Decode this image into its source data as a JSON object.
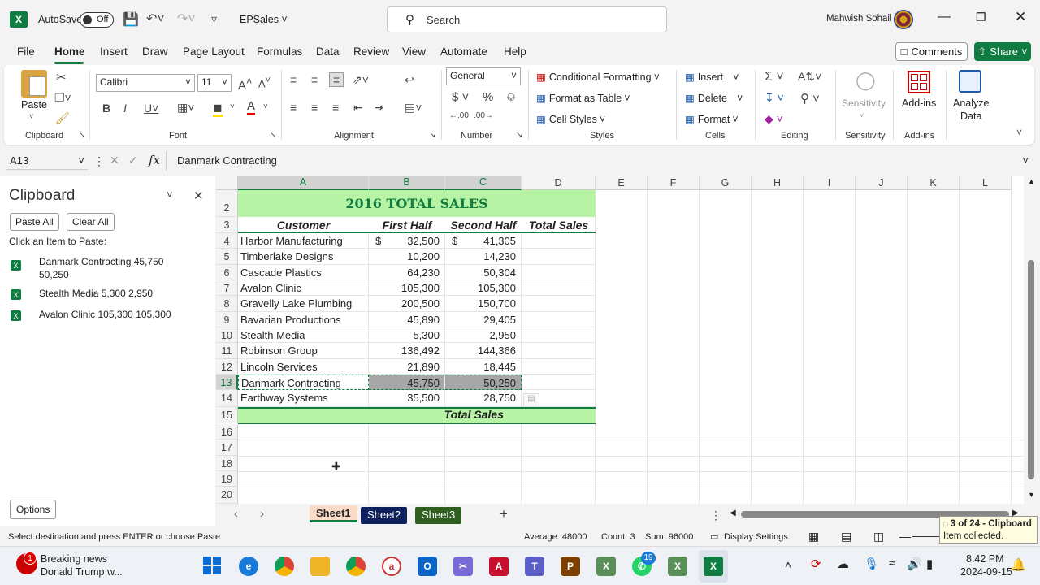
{
  "title_bar": {
    "autosave_label": "AutoSave",
    "autosave_state": "Off",
    "filename": "EPSales",
    "search_placeholder": "Search",
    "user": "Mahwish Sohail"
  },
  "menu": {
    "tabs": [
      "File",
      "Home",
      "Insert",
      "Draw",
      "Page Layout",
      "Formulas",
      "Data",
      "Review",
      "View",
      "Automate",
      "Help"
    ],
    "comments": "Comments",
    "share": "Share"
  },
  "ribbon": {
    "clipboard": {
      "label": "Clipboard",
      "paste": "Paste"
    },
    "font": {
      "label": "Font",
      "name": "Calibri",
      "size": "11"
    },
    "alignment": {
      "label": "Alignment"
    },
    "number": {
      "label": "Number",
      "format": "General"
    },
    "styles": {
      "label": "Styles",
      "conditional": "Conditional Formatting",
      "format_table": "Format as Table",
      "cell_styles": "Cell Styles"
    },
    "cells": {
      "label": "Cells",
      "insert": "Insert",
      "delete": "Delete",
      "format": "Format"
    },
    "editing": {
      "label": "Editing"
    },
    "sensitivity": {
      "label": "Sensitivity",
      "button": "Sensitivity"
    },
    "addins": {
      "label": "Add-ins",
      "button": "Add-ins"
    },
    "analyze": {
      "line1": "Analyze",
      "line2": "Data"
    }
  },
  "formula_bar": {
    "name_box": "A13",
    "formula": "Danmark Contracting"
  },
  "clipboard_pane": {
    "title": "Clipboard",
    "paste_all": "Paste All",
    "clear_all": "Clear All",
    "instruction": "Click an Item to Paste:",
    "items": [
      {
        "line1": "Danmark Contracting 45,750",
        "line2": "50,250"
      },
      {
        "line1": "Stealth Media 5,300 2,950",
        "line2": ""
      },
      {
        "line1": "Avalon Clinic 105,300 105,300",
        "line2": ""
      }
    ],
    "options": "Options"
  },
  "sheet": {
    "columns": [
      "A",
      "B",
      "C",
      "D",
      "E",
      "F",
      "G",
      "H",
      "I",
      "J",
      "K",
      "L"
    ],
    "title": "2016 TOTAL SALES",
    "headers": [
      "Customer",
      "First Half",
      "Second Half",
      "Total Sales"
    ],
    "rows": [
      {
        "num": "4",
        "customer": "Harbor Manufacturing",
        "first": "32,500",
        "second": "41,305",
        "dollar": true
      },
      {
        "num": "5",
        "customer": "Timberlake Designs",
        "first": "10,200",
        "second": "14,230"
      },
      {
        "num": "6",
        "customer": "Cascade Plastics",
        "first": "64,230",
        "second": "50,304"
      },
      {
        "num": "7",
        "customer": "Avalon Clinic",
        "first": "105,300",
        "second": "105,300"
      },
      {
        "num": "8",
        "customer": "Gravelly Lake Plumbing",
        "first": "200,500",
        "second": "150,700"
      },
      {
        "num": "9",
        "customer": "Bavarian Productions",
        "first": "45,890",
        "second": "29,405"
      },
      {
        "num": "10",
        "customer": "Stealth Media",
        "first": "5,300",
        "second": "2,950"
      },
      {
        "num": "11",
        "customer": "Robinson Group",
        "first": "136,492",
        "second": "144,366"
      },
      {
        "num": "12",
        "customer": "Lincoln Services",
        "first": "21,890",
        "second": "18,445"
      },
      {
        "num": "13",
        "customer": "Danmark Contracting",
        "first": "45,750",
        "second": "50,250",
        "selected": true
      },
      {
        "num": "14",
        "customer": "Earthway Systems",
        "first": "35,500",
        "second": "28,750"
      }
    ],
    "dollar_sign": "$",
    "total_label": "Total Sales",
    "row_numbers_top": [
      "2",
      "3"
    ],
    "row_numbers_bottom": [
      "15",
      "16",
      "17",
      "18",
      "19",
      "20"
    ]
  },
  "sheet_tabs": [
    "Sheet1",
    "Sheet2",
    "Sheet3"
  ],
  "status_bar": {
    "message": "Select destination and press ENTER or choose Paste",
    "average": "Average: 48000",
    "count": "Count: 3",
    "sum": "Sum: 96000",
    "display_settings": "Display Settings"
  },
  "toast": {
    "line1": "3 of 24 - Clipboard",
    "line2": "Item collected."
  },
  "taskbar": {
    "news_title": "Breaking news",
    "news_sub": "Donald Trump w...",
    "news_badge": "1",
    "whatsapp_badge": "19",
    "time": "8:42 PM",
    "date": "2024-09-15"
  }
}
